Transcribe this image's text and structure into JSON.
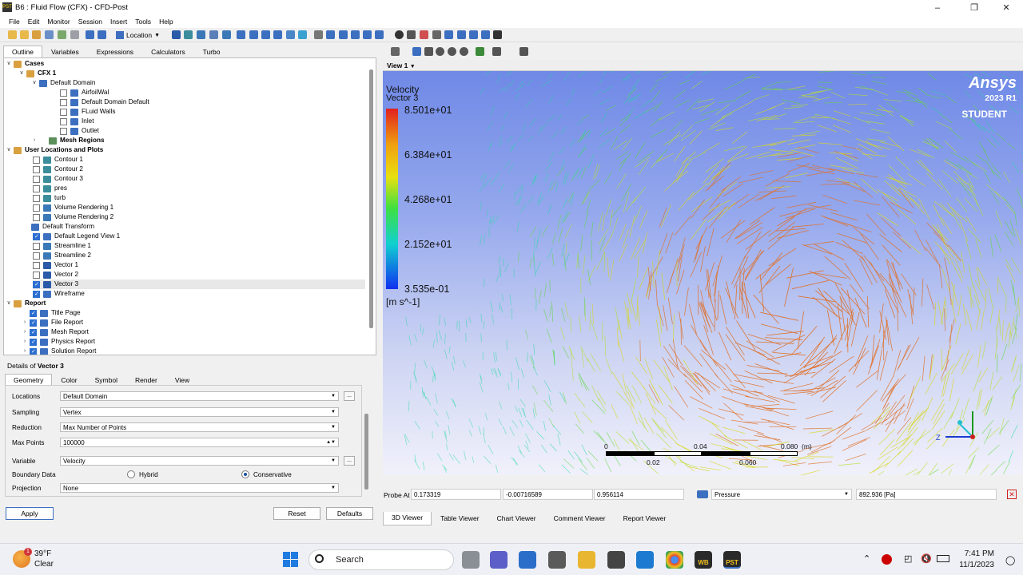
{
  "window": {
    "title": "B6 : Fluid Flow (CFX) - CFD-Post",
    "app_icon": "PST"
  },
  "menu": [
    "File",
    "Edit",
    "Monitor",
    "Session",
    "Insert",
    "Tools",
    "Help"
  ],
  "toolbar": {
    "location_label": "Location"
  },
  "left_tabs": [
    "Outline",
    "Variables",
    "Expressions",
    "Calculators",
    "Turbo"
  ],
  "tree": {
    "cases": "Cases",
    "cfx1": "CFX 1",
    "default_domain": "Default Domain",
    "domain_items": [
      "AirfoilWal",
      "Default Domain Default",
      "FLuid Walls",
      "Inlet",
      "Outlet"
    ],
    "mesh_regions": "Mesh Regions",
    "user_locations": "User Locations and Plots",
    "plots": [
      {
        "label": "Contour 1",
        "checked": false
      },
      {
        "label": "Contour 2",
        "checked": false
      },
      {
        "label": "Contour 3",
        "checked": false
      },
      {
        "label": "pres",
        "checked": false
      },
      {
        "label": "turb",
        "checked": false
      },
      {
        "label": "Volume Rendering 1",
        "checked": false
      },
      {
        "label": "Volume Rendering 2",
        "checked": false
      }
    ],
    "default_transform": "Default Transform",
    "plots2": [
      {
        "label": "Default Legend View 1",
        "checked": true
      },
      {
        "label": "Streamline 1",
        "checked": false
      },
      {
        "label": "Streamline 2",
        "checked": false
      },
      {
        "label": "Vector 1",
        "checked": false
      },
      {
        "label": "Vector 2",
        "checked": false
      },
      {
        "label": "Vector 3",
        "checked": true
      },
      {
        "label": "Wireframe",
        "checked": true
      }
    ],
    "report": "Report",
    "report_items": [
      "Title Page",
      "File Report",
      "Mesh Report",
      "Physics Report",
      "Solution Report"
    ]
  },
  "details": {
    "title_prefix": "Details of",
    "title_name": "Vector 3",
    "tabs": [
      "Geometry",
      "Color",
      "Symbol",
      "Render",
      "View"
    ],
    "locations_label": "Locations",
    "locations_value": "Default Domain",
    "sampling_label": "Sampling",
    "sampling_value": "Vertex",
    "reduction_label": "Reduction",
    "reduction_value": "Max Number of Points",
    "maxpoints_label": "Max Points",
    "maxpoints_value": "100000",
    "variable_label": "Variable",
    "variable_value": "Velocity",
    "boundary_label": "Boundary Data",
    "boundary_hybrid": "Hybrid",
    "boundary_conservative": "Conservative",
    "projection_label": "Projection",
    "projection_value": "None",
    "ellipsis": "...",
    "apply": "Apply",
    "reset": "Reset",
    "defaults": "Defaults"
  },
  "viewer": {
    "view_label": "View 1",
    "legend": {
      "title": "Velocity",
      "subtitle": "Vector 3",
      "values": [
        "8.501e+01",
        "6.384e+01",
        "4.268e+01",
        "2.152e+01",
        "3.535e-01"
      ],
      "units": "[m s^-1]"
    },
    "brand": {
      "logo": "Ansys",
      "version": "2023 R1",
      "edition": "STUDENT"
    },
    "scale": {
      "top_ticks": [
        "0",
        "0.04",
        "0.080  (m)"
      ],
      "bottom_ticks": [
        "0.02",
        "0.060"
      ]
    }
  },
  "probe": {
    "label": "Probe At",
    "x": "0.173319",
    "y": "-0.00716589",
    "z": "0.956114",
    "variable": "Pressure",
    "result": "892.936 [Pa]"
  },
  "viewer_tabs": [
    "3D Viewer",
    "Table Viewer",
    "Chart Viewer",
    "Comment Viewer",
    "Report Viewer"
  ],
  "taskbar": {
    "weather_temp": "39°F",
    "weather_cond": "Clear",
    "weather_badge": "1",
    "search_placeholder": "Search",
    "time": "7:41 PM",
    "date": "11/1/2023",
    "wb_label": "WB",
    "pst_label": "PST"
  },
  "colors": {
    "accent": "#2d6fd0",
    "sky_top": "#6f89e6",
    "sky_bottom": "#f1f1fb"
  }
}
